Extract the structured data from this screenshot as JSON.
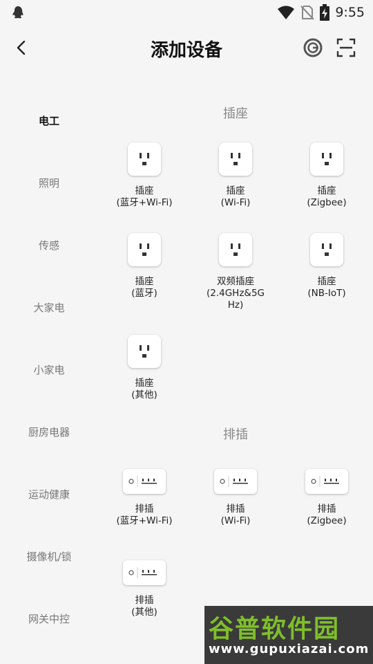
{
  "status_bar": {
    "time": "9:55",
    "icons": [
      "qq-penguin-icon",
      "wifi-icon",
      "no-sim-icon",
      "battery-charging-icon"
    ]
  },
  "header": {
    "title": "添加设备",
    "icons": [
      "back-arrow-icon",
      "target-icon",
      "scan-icon"
    ]
  },
  "sidebar": {
    "items": [
      {
        "label": "电工",
        "active": true
      },
      {
        "label": "照明"
      },
      {
        "label": "传感"
      },
      {
        "label": "大家电"
      },
      {
        "label": "小家电"
      },
      {
        "label": "厨房电器"
      },
      {
        "label": "运动健康"
      },
      {
        "label": "摄像机/锁"
      },
      {
        "label": "网关中控"
      }
    ]
  },
  "sections": [
    {
      "title": "插座",
      "devices": [
        {
          "label": "插座\n(蓝牙+Wi-Fi)",
          "icon": "socket-icon"
        },
        {
          "label": "插座\n(Wi-Fi)",
          "icon": "socket-icon"
        },
        {
          "label": "插座\n(Zigbee)",
          "icon": "socket-icon"
        },
        {
          "label": "插座\n(蓝牙)",
          "icon": "socket-icon"
        },
        {
          "label": "双频插座\n(2.4GHz&5G\nHz)",
          "icon": "socket-icon"
        },
        {
          "label": "插座\n(NB-IoT)",
          "icon": "socket-icon"
        },
        {
          "label": "插座\n(其他)",
          "icon": "socket-icon"
        }
      ]
    },
    {
      "title": "排插",
      "devices": [
        {
          "label": "排插\n(蓝牙+Wi-Fi)",
          "icon": "power-strip-icon"
        },
        {
          "label": "排插\n(Wi-Fi)",
          "icon": "power-strip-icon"
        },
        {
          "label": "排插\n(Zigbee)",
          "icon": "power-strip-icon"
        },
        {
          "label": "排插\n(其他)",
          "icon": "power-strip-icon"
        }
      ]
    }
  ],
  "watermark": {
    "logo_text": "谷普软件园",
    "url": "www.gupuxiazai.com"
  },
  "colors": {
    "background": "#f5f5f5",
    "watermark_bg": "#3a3a3a",
    "watermark_logo": "#7fbf2a"
  }
}
